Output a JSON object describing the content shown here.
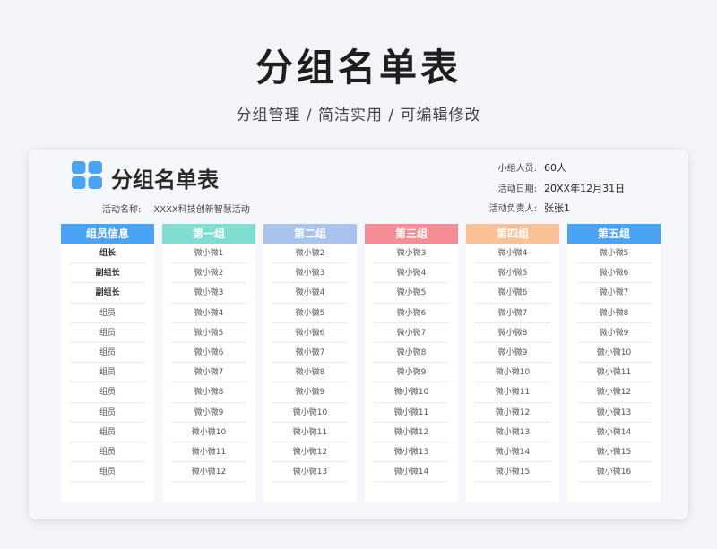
{
  "header": {
    "title": "分组名单表",
    "subtitle": "分组管理 / 简洁实用 / 可编辑修改"
  },
  "sheet": {
    "title": "分组名单表",
    "activity_label": "活动名称:",
    "activity_value": "XXXX科技创新智慧活动",
    "group_size_label": "小组人员:",
    "group_size_value": "60人",
    "date_label": "活动日期:",
    "date_value": "20XX年12月31日",
    "lead_label": "活动负责人:",
    "lead_value": "张张1"
  },
  "colors": {
    "info": "#4ba3f5",
    "group1": "#7fddd1",
    "group2": "#a9c3ee",
    "group3": "#f58c96",
    "group4": "#f9c195",
    "group5": "#4ba3f5"
  },
  "columns": [
    {
      "key": "info",
      "header": "组员信息",
      "items": [
        "组长",
        "副组长",
        "副组长",
        "组员",
        "组员",
        "组员",
        "组员",
        "组员",
        "组员",
        "组员",
        "组员",
        "组员"
      ]
    },
    {
      "key": "group1",
      "header": "第一组",
      "items": [
        "微小微1",
        "微小微2",
        "微小微3",
        "微小微4",
        "微小微5",
        "微小微6",
        "微小微7",
        "微小微8",
        "微小微9",
        "微小微10",
        "微小微11",
        "微小微12"
      ]
    },
    {
      "key": "group2",
      "header": "第二组",
      "items": [
        "微小微2",
        "微小微3",
        "微小微4",
        "微小微5",
        "微小微6",
        "微小微7",
        "微小微8",
        "微小微9",
        "微小微10",
        "微小微11",
        "微小微12",
        "微小微13"
      ]
    },
    {
      "key": "group3",
      "header": "第三组",
      "items": [
        "微小微3",
        "微小微4",
        "微小微5",
        "微小微6",
        "微小微7",
        "微小微8",
        "微小微9",
        "微小微10",
        "微小微11",
        "微小微12",
        "微小微13",
        "微小微14"
      ]
    },
    {
      "key": "group4",
      "header": "第四组",
      "items": [
        "微小微4",
        "微小微5",
        "微小微6",
        "微小微7",
        "微小微8",
        "微小微9",
        "微小微10",
        "微小微11",
        "微小微12",
        "微小微13",
        "微小微14",
        "微小微15"
      ]
    },
    {
      "key": "group5",
      "header": "第五组",
      "items": [
        "微小微5",
        "微小微6",
        "微小微7",
        "微小微8",
        "微小微9",
        "微小微10",
        "微小微11",
        "微小微12",
        "微小微13",
        "微小微14",
        "微小微15",
        "微小微16"
      ]
    }
  ]
}
